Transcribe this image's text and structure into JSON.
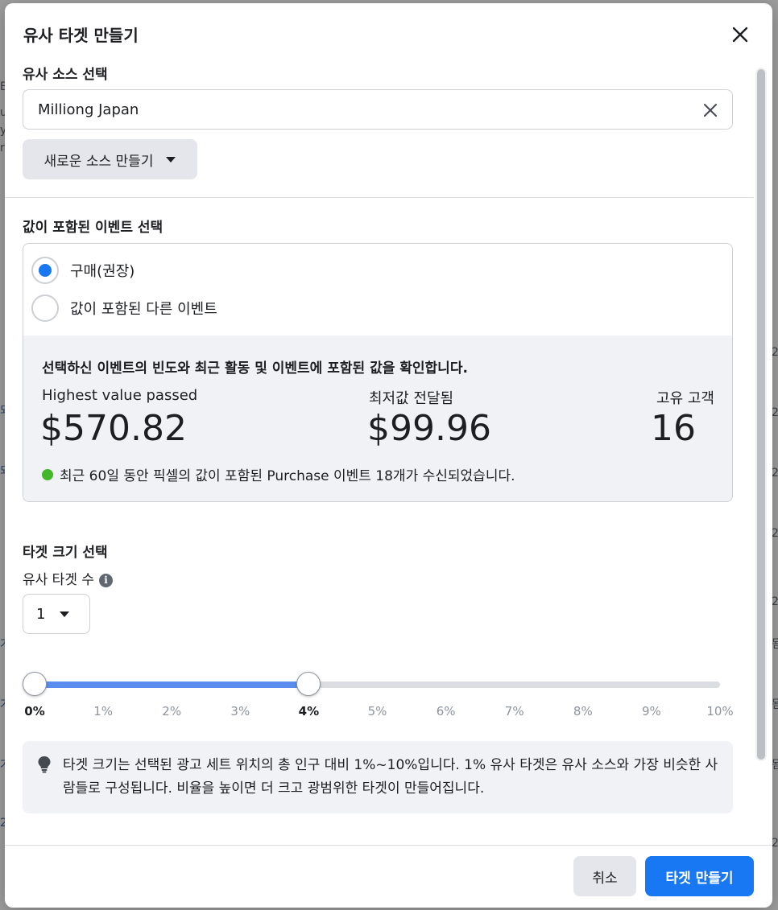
{
  "dialog": {
    "title": "유사 타겟 만들기"
  },
  "source_section": {
    "heading": "유사 소스 선택",
    "selected_value": "Milliong Japan",
    "create_source_label": "새로운 소스 만들기"
  },
  "event_section": {
    "heading": "값이 포함된 이벤트 선택",
    "options": [
      {
        "label": "구매(권장)",
        "selected": true
      },
      {
        "label": "값이 포함된 다른 이벤트",
        "selected": false
      }
    ],
    "stats": {
      "description": "선택하신 이벤트의 빈도와 최근 활동 및 이벤트에 포함된 값을 확인합니다.",
      "highest_label": "Highest value passed",
      "highest_value": "$570.82",
      "lowest_label": "최저값 전달됨",
      "lowest_value": "$99.96",
      "unique_label": "고유 고객",
      "unique_value": "16",
      "note": "최근 60일 동안 픽셀의 값이 포함된 Purchase 이벤트 18개가 수신되었습니다."
    }
  },
  "size_section": {
    "heading": "타겟 크기 선택",
    "count_label": "유사 타겟 수",
    "count_value": "1",
    "slider": {
      "start_percent": 0,
      "end_percent": 4,
      "ticks": [
        "0%",
        "1%",
        "2%",
        "3%",
        "4%",
        "5%",
        "6%",
        "7%",
        "8%",
        "9%",
        "10%"
      ]
    },
    "tip": "타겟 크기는 선택된 광고 세트 위치의 총 인구 대비 1%~10%입니다. 1% 유사 타겟은 유사 소스와 가장 비슷한 사람들로 구성됩니다. 비율을 높이면 더 크고 광범위한 타겟이 만들어집니다."
  },
  "footer": {
    "cancel_label": "취소",
    "create_label": "타겟 만들기"
  },
  "colors": {
    "primary": "#1877f2",
    "slider_fill": "#5a8dee",
    "success_dot": "#42b72a"
  }
}
